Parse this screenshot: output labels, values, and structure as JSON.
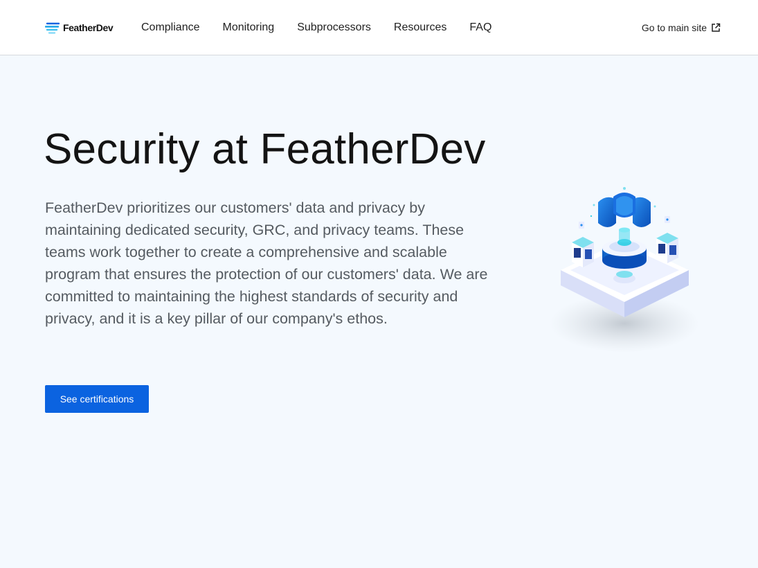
{
  "header": {
    "brand": "FeatherDev",
    "nav": [
      {
        "label": "Compliance"
      },
      {
        "label": "Monitoring"
      },
      {
        "label": "Subprocessors"
      },
      {
        "label": "Resources"
      },
      {
        "label": "FAQ"
      }
    ],
    "main_site_label": "Go to main site",
    "main_site_icon": "external-link-icon"
  },
  "hero": {
    "title": "Security at FeatherDev",
    "description": "FeatherDev prioritizes our customers' data and privacy by maintaining dedicated security, GRC, and privacy teams. These teams work together to create a comprehensive and scalable program that ensures the protection of our customers' data. We are committed to maintaining the highest standards of security and privacy, and it is a key pillar of our company's ethos.",
    "cta_label": "See certifications",
    "illustration": "isometric-security-server-illustration"
  },
  "colors": {
    "background": "#f4f9fe",
    "header_background": "#ffffff",
    "accent": "#0b63e0",
    "text_primary": "#141414",
    "text_secondary": "#555b61"
  }
}
